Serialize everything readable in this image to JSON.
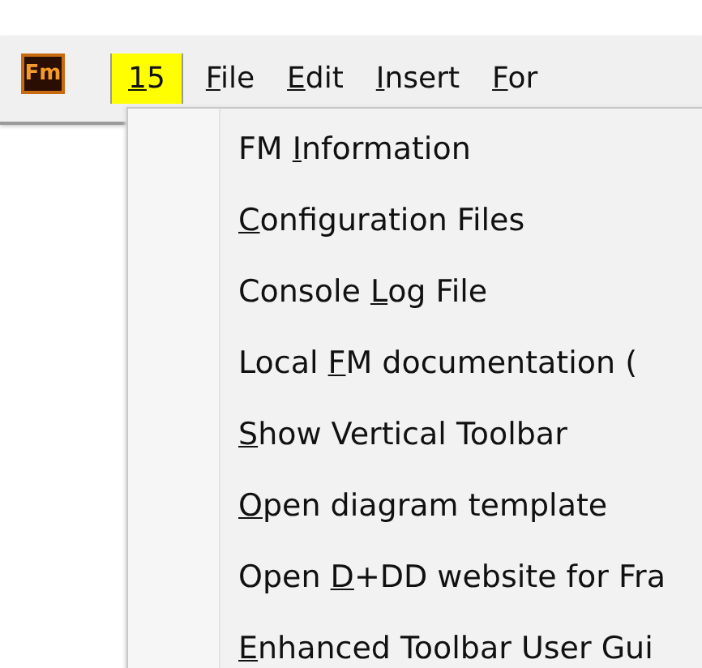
{
  "app_logo": {
    "text": "Fm"
  },
  "menu_bar": [
    {
      "key": "1",
      "after": "5",
      "selected": true
    },
    {
      "key": "F",
      "after": "ile",
      "selected": false
    },
    {
      "key": "E",
      "after": "dit",
      "selected": false
    },
    {
      "key": "I",
      "after": "nsert",
      "selected": false
    },
    {
      "key": "F",
      "after": "or",
      "selected": false
    }
  ],
  "dropdown": [
    {
      "before": "FM ",
      "key": "I",
      "after": "nformation"
    },
    {
      "key": "C",
      "after": "onfiguration Files"
    },
    {
      "before": "Console ",
      "key": "L",
      "after": "og File"
    },
    {
      "before": "Local ",
      "key": "F",
      "after": "M documentation ("
    },
    {
      "key": "S",
      "after": "how Vertical Toolbar"
    },
    {
      "key": "O",
      "after": "pen diagram template"
    },
    {
      "before": "Open ",
      "key": "D",
      "after": "+DD website for Fra"
    },
    {
      "key": "E",
      "after": "nhanced Toolbar User Gui"
    }
  ]
}
